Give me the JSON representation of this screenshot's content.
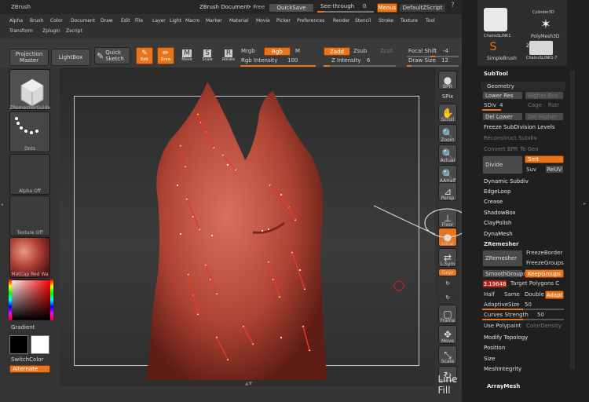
{
  "titlebar": {
    "app": "ZBrush",
    "doc": "ZBrush Document",
    "free": "• Free",
    "quicksave": "QuickSave",
    "seethrough": "See-through",
    "seethrough_val": "0",
    "menus": "Menus",
    "defaultscript": "DefaultZScript"
  },
  "menubar": [
    "Alpha",
    "Brush",
    "Color",
    "Document",
    "Draw",
    "Edit",
    "File",
    "Layer",
    "Light",
    "Macro",
    "Marker",
    "Material",
    "Movie",
    "Picker",
    "Preferences",
    "Render",
    "Stencil",
    "Stroke",
    "Texture",
    "Tool"
  ],
  "menubar2": [
    "Transform",
    "Zplugin",
    "Zscript"
  ],
  "shelf": {
    "projection": "Projection Master",
    "lightbox": "LightBox",
    "quicksketch": "Quick Sketch",
    "edit": "Edit",
    "draw": "Draw",
    "move": "Move",
    "scale": "Scale",
    "rotate": "Rotate",
    "mrgb": "Mrgb",
    "rgb": "Rgb",
    "m": "M",
    "rgb_intensity": "Rgb Intensity",
    "rgb_intensity_val": "100",
    "zadd": "Zadd",
    "zsub": "Zsub",
    "zcut": "Zcut",
    "z_intensity": "Z Intensity",
    "z_intensity_val": "6",
    "focal": "Focal Shift",
    "focal_val": "-4",
    "drawsize": "Draw Size",
    "drawsize_val": "12"
  },
  "left": {
    "brush_label": "ZRemesherGuide",
    "stroke_label": "Dots",
    "alpha_label": "Alpha Off",
    "texture_label": "Texture Off",
    "material_label": "MatCap Red Wa",
    "gradient": "Gradient",
    "switchcolor": "SwitchColor",
    "alternate": "Alternate"
  },
  "righttools": [
    {
      "icon": "●",
      "label": "BPR"
    },
    {
      "icon": "—",
      "label": "SPix"
    },
    {
      "icon": "✋",
      "label": "Scroll"
    },
    {
      "icon": "🔍",
      "label": "Zoom"
    },
    {
      "icon": "🔍",
      "label": "Actual"
    },
    {
      "icon": "🔍",
      "label": "AAHalf"
    },
    {
      "icon": "⊿",
      "label": "Persp"
    },
    {
      "icon": "⊥",
      "label": "Floor"
    },
    {
      "icon": "●",
      "label": "Local"
    },
    {
      "icon": "⇄",
      "label": "L.Sym"
    },
    {
      "icon": "xyz",
      "label": "Gxyz"
    },
    {
      "icon": "↻",
      "label": ""
    },
    {
      "icon": "↻",
      "label": ""
    },
    {
      "icon": "▢",
      "label": "Frame"
    },
    {
      "icon": "✥",
      "label": "Move"
    },
    {
      "icon": "⤡",
      "label": "Scale"
    },
    {
      "icon": "↻",
      "label": "Rotate"
    },
    {
      "icon": "",
      "label": "Line Fill"
    }
  ],
  "toolpalette": {
    "items": [
      "ChainsSLINK1",
      "Cylinder3D",
      "PolyMesh3D",
      "SimpleBrush",
      "ChainsSLINK1-7"
    ],
    "count": "2"
  },
  "subtool": "SubTool",
  "geometry": {
    "title": "Geometry",
    "lower_res": "Lower Res",
    "higher_res": "Higher Res",
    "sdiv": "SDiv",
    "sdiv_val": "4",
    "cage": "Cage",
    "rstr": "Rstr",
    "del_lower": "Del Lower",
    "del_higher": "Del Higher",
    "freeze": "Freeze SubDivision Levels",
    "reconstruct": "Reconstruct Subdiv",
    "convert_bpr": "Convert BPR To Geo",
    "divide": "Divide",
    "smt": "Smt",
    "suv": "Suv",
    "reuv": "ReUV",
    "dynamic": "Dynamic Subdiv",
    "edgeloop": "EdgeLoop",
    "crease": "Crease",
    "shadowbox": "ShadowBox",
    "claypolish": "ClayPolish",
    "dynamesh": "DynaMesh",
    "zremesher": "ZRemesher",
    "zremesher_btn": "ZRemesher",
    "freezeborder": "FreezeBorder",
    "freezegroups": "FreezeGroups",
    "smoothgroups": "SmoothGroups",
    "keepgroups": "KeepGroups",
    "target_val": "3.19648",
    "target": "Target Polygons C",
    "half": "Half",
    "same": "Same",
    "double": "Double",
    "adapt": "Adapt",
    "adaptivesize": "AdaptiveSize",
    "adaptivesize_val": "50",
    "curvesstrength": "Curves Strength",
    "curvesstrength_val": "50",
    "usepolypaint": "Use Polypaint",
    "colordensity": "ColorDensity",
    "modifytopology": "Modify Topology",
    "position": "Position",
    "size": "Size",
    "meshintegrity": "MeshIntegrity"
  },
  "arraymesh": "ArrayMesh"
}
